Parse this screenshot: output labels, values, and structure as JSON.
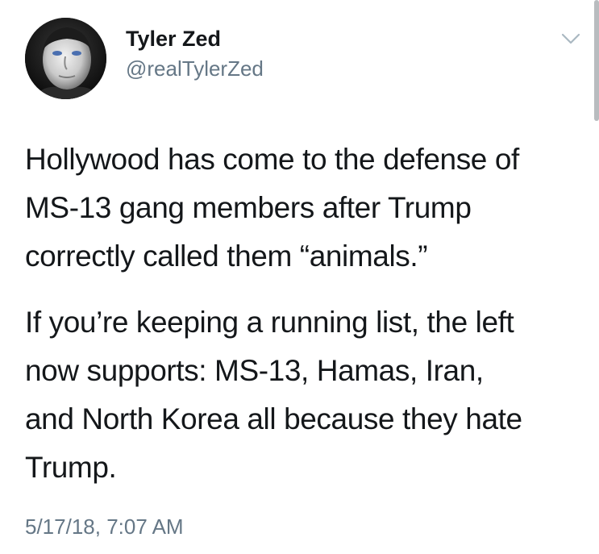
{
  "tweet": {
    "author": {
      "display_name": "Tyler Zed",
      "handle": "@realTylerZed",
      "avatar_icon": "profile-photo"
    },
    "menu_icon": "chevron-down-icon",
    "text": {
      "paragraph_1_lines": [
        "Hollywood has come to the defense of",
        "MS-13 gang members after Trump",
        "correctly called them “animals.”"
      ],
      "paragraph_2_lines": [
        "If you’re keeping a running list, the left",
        "now supports: MS-13, Hamas, Iran,",
        "and North Korea all because they hate",
        "Trump."
      ]
    },
    "timestamp": "5/17/18, 7:07 AM"
  },
  "colors": {
    "text_primary": "#14171a",
    "text_secondary": "#657786",
    "background": "#ffffff",
    "chevron": "#aab8c2"
  }
}
